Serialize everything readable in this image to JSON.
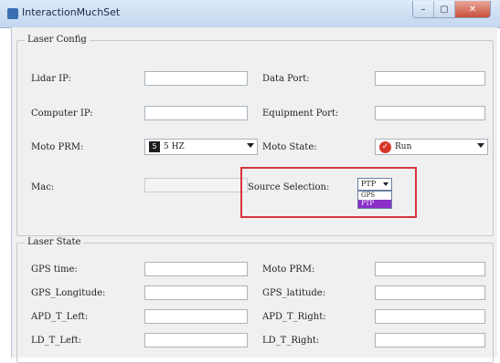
{
  "window": {
    "title": "InteractionMuchSet"
  },
  "laser_config": {
    "legend": "Laser Config",
    "lidar_ip_label": "Lidar IP:",
    "data_port_label": "Data Port:",
    "computer_ip_label": "Computer IP:",
    "equipment_port_label": "Equipment Port:",
    "moto_prm_label": "Moto PRM:",
    "moto_prm_value": "5 HZ",
    "moto_prm_badge": "5",
    "moto_state_label": "Moto State:",
    "moto_state_value": "Run",
    "mac_label": "Mac:",
    "source_selection_label": "Source Selection:",
    "source_selection_value": "PTP",
    "source_options": [
      "GPS",
      "PTP"
    ]
  },
  "laser_state": {
    "legend": "Laser State",
    "gps_time_label": "GPS time:",
    "moto_prm_label": "Moto PRM:",
    "gps_longitude_label": "GPS_Longitude:",
    "gps_latitude_label": "GPS_latitude:",
    "apd_t_left_label": "APD_T_Left:",
    "apd_t_right_label": "APD_T_Right:",
    "ld_t_left_label": "LD_T_Left:",
    "ld_t_right_label": "LD_T_Right:"
  },
  "colors": {
    "highlight": "#d4363d",
    "selected_option": "#8b2fc9"
  }
}
